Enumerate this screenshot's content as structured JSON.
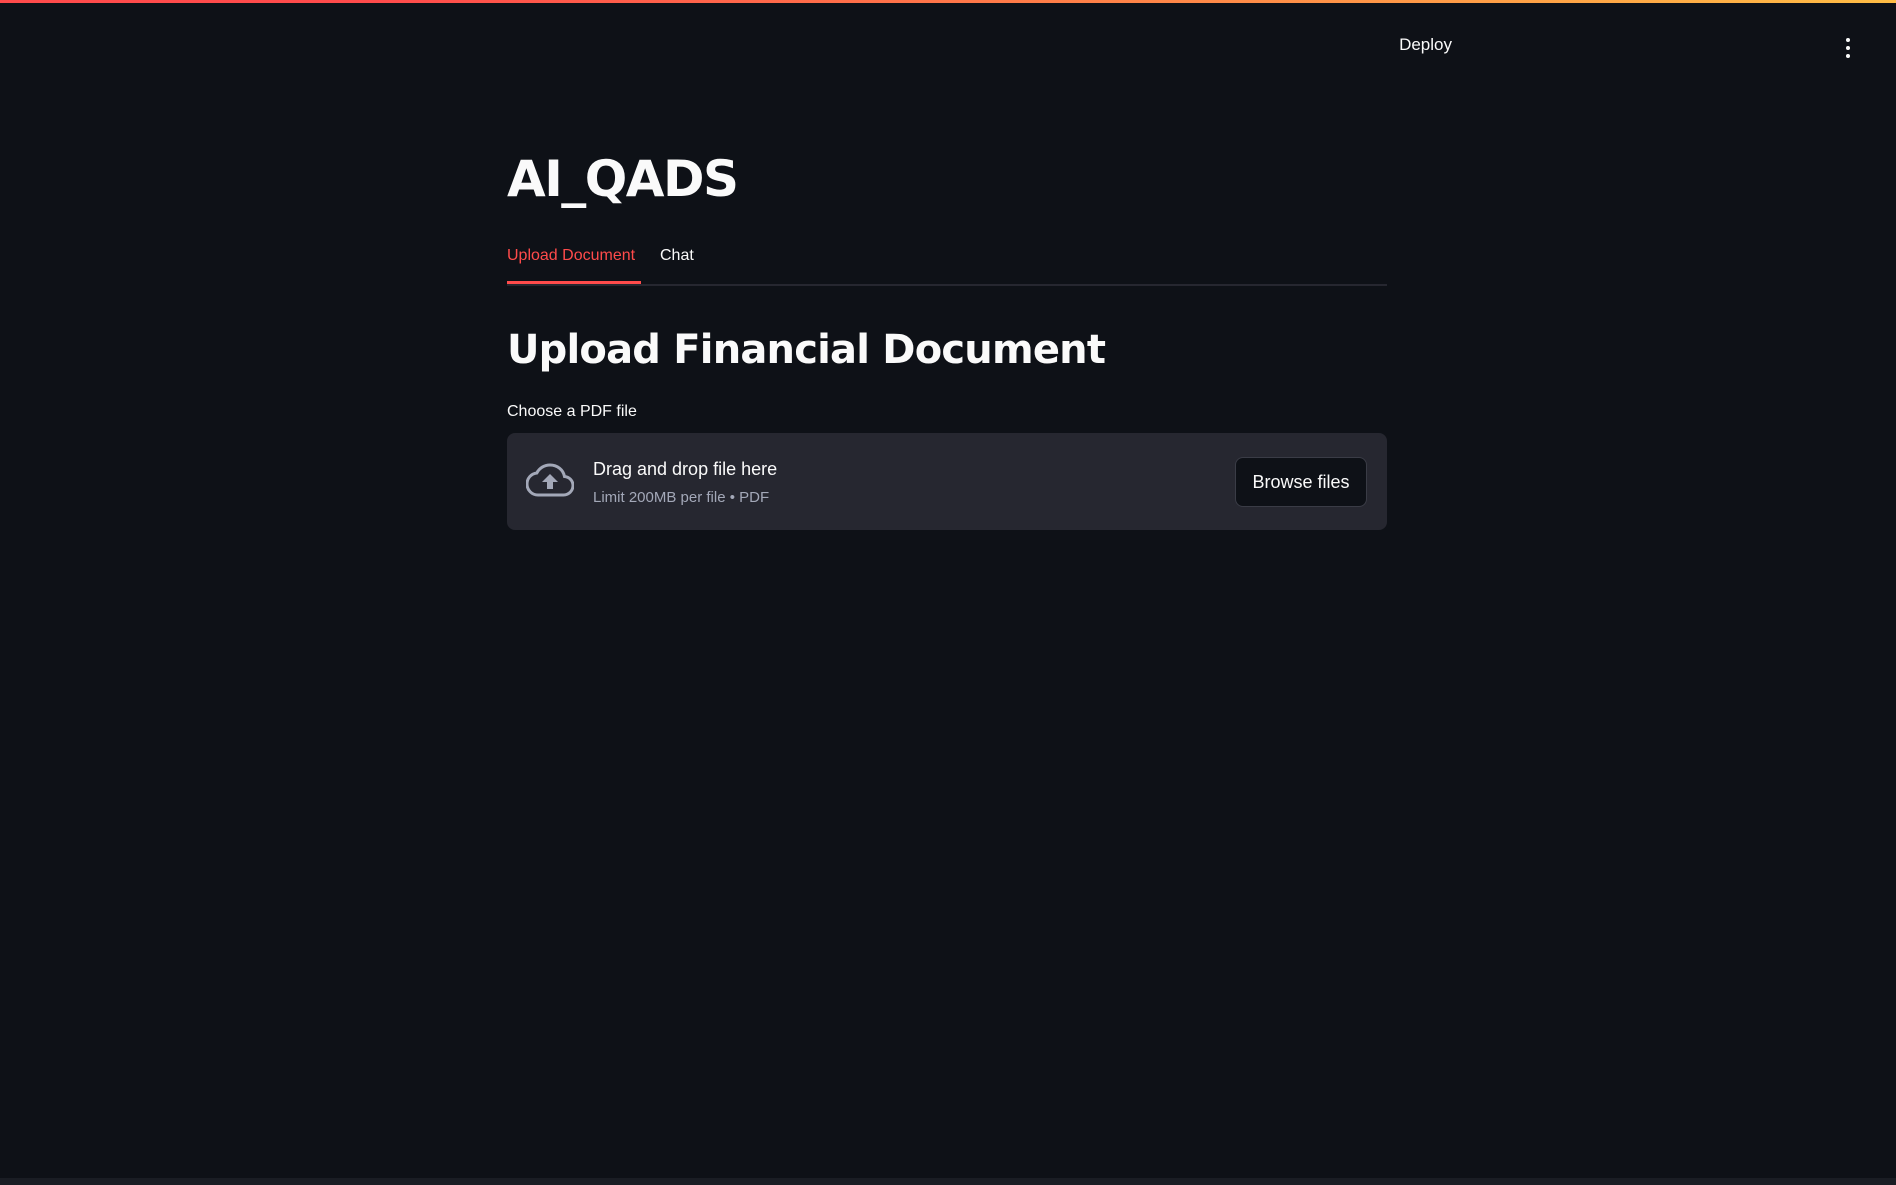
{
  "header": {
    "deploy_label": "Deploy",
    "menu_icon": "vertical-ellipsis-icon"
  },
  "app": {
    "title": "AI_QADS"
  },
  "tabs": [
    {
      "label": "Upload Document",
      "active": true
    },
    {
      "label": "Chat",
      "active": false
    }
  ],
  "upload_section": {
    "heading": "Upload Financial Document",
    "uploader_label": "Choose a PDF file",
    "drop_text": "Drag and drop file here",
    "limit_text": "Limit 200MB per file • PDF",
    "browse_label": "Browse files",
    "icon": "cloud-upload-icon"
  },
  "colors": {
    "background": "#0e1117",
    "accent": "#ff4b4b",
    "dropzone": "#262730",
    "gradient_end": "#ffbd45"
  }
}
